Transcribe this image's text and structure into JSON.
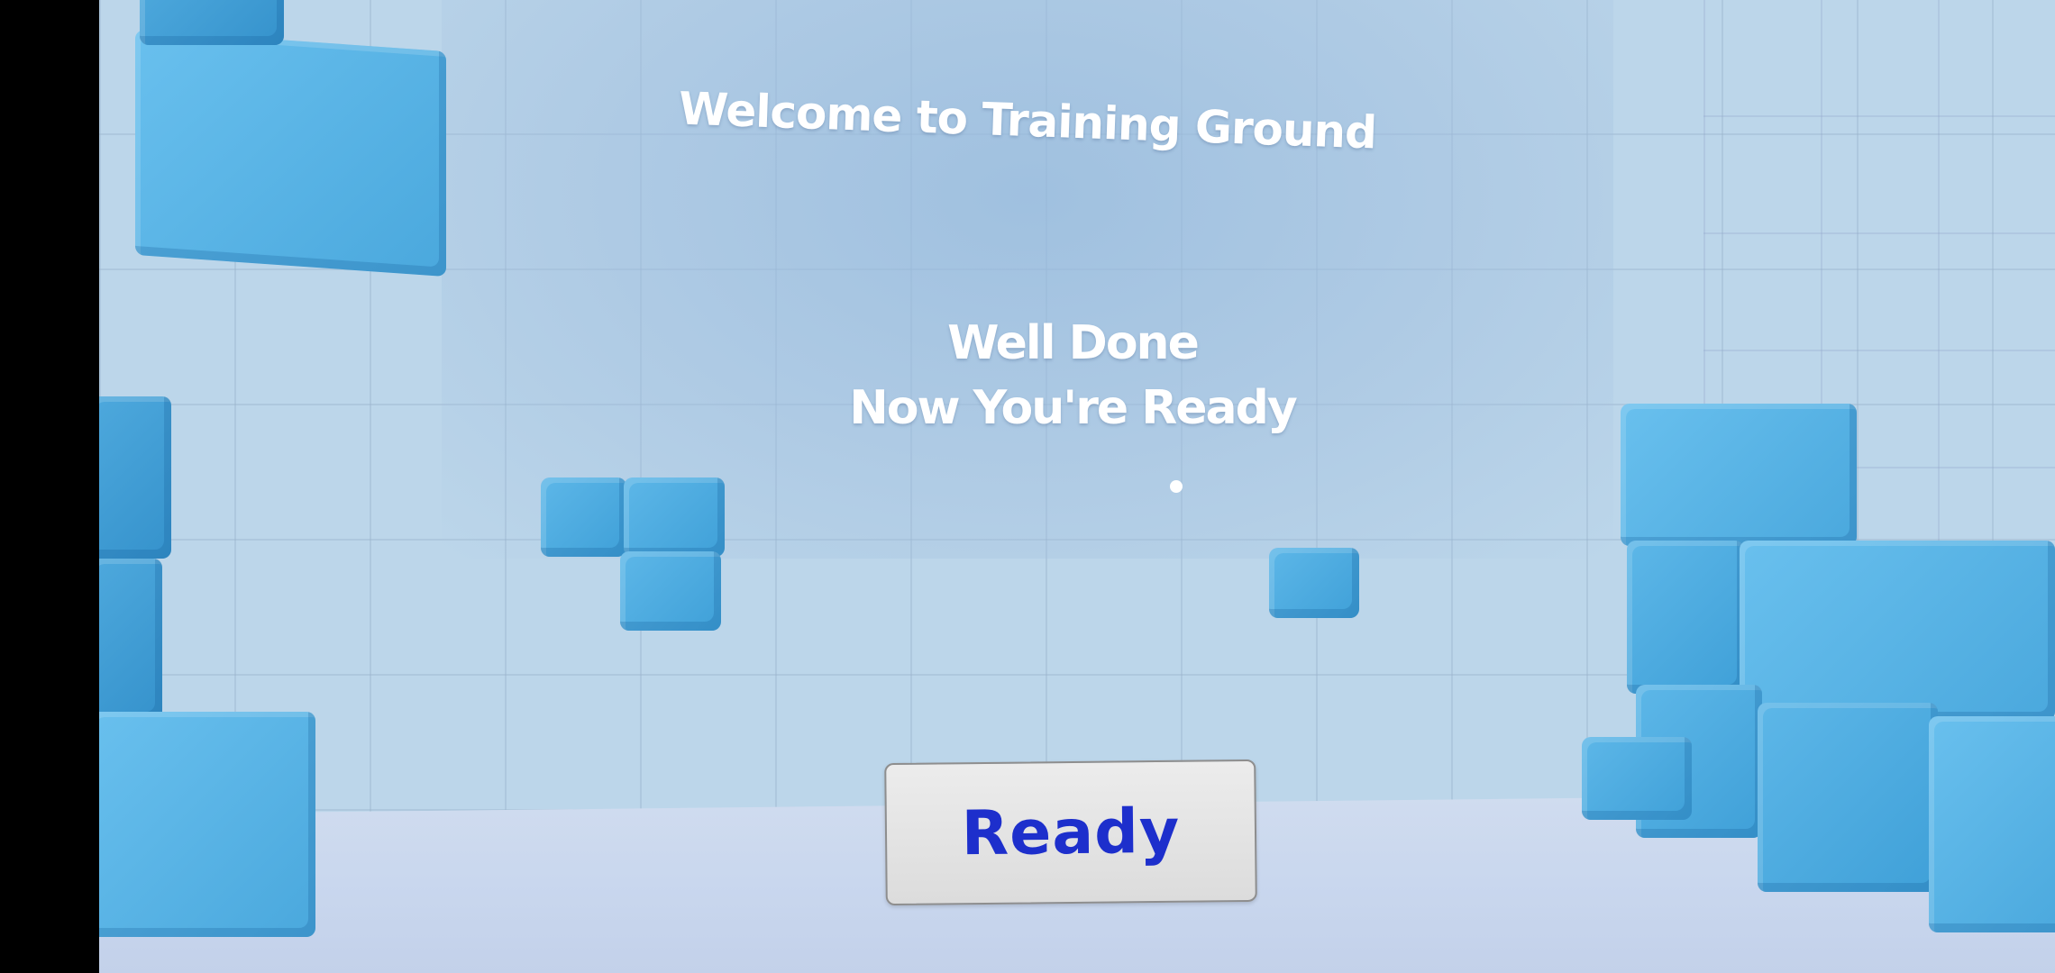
{
  "scene": {
    "title": "Welcome to Training Ground",
    "message_line1": "Well Done",
    "message_line2": "Now You're Ready"
  },
  "button": {
    "ready_label": "Ready"
  },
  "colors": {
    "text": "#ffffff",
    "button_text": "#1d2fcc",
    "cube": "#4aa8dd",
    "wall": "#bcd6ea"
  }
}
